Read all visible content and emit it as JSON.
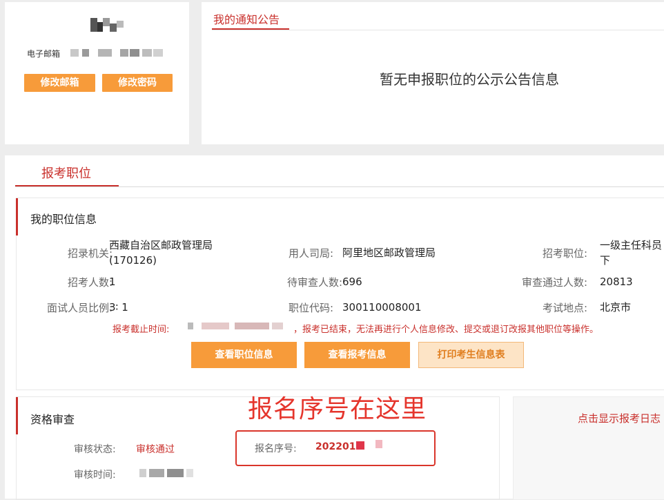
{
  "profile": {
    "email_label": "电子邮箱",
    "buttons": {
      "change_email": "修改邮箱",
      "change_password": "修改密码"
    }
  },
  "notice": {
    "tab": "我的通知公告",
    "empty_message": "暂无申报职位的公示公告信息"
  },
  "main": {
    "tab": "报考职位",
    "position_section": {
      "title": "我的职位信息",
      "fields": {
        "agency_label": "招录机关:",
        "agency_value": "西藏自治区邮政管理局",
        "agency_code": "(170126)",
        "employer_label": "用人司局:",
        "employer_value": "阿里地区邮政管理局",
        "position_label": "招考职位:",
        "position_value_1": "一级主任科员",
        "position_value_2": "下",
        "quota_label": "招考人数:",
        "quota_value": "1",
        "pending_label": "待审查人数:",
        "pending_value": "696",
        "approved_label": "审查通过人数:",
        "approved_value": "20813",
        "ratio_label": "面试人员比例:",
        "ratio_value": "3∶ 1",
        "code_label": "职位代码:",
        "code_value": "300110008001",
        "location_label": "考试地点:",
        "location_value": "北京市"
      },
      "deadline_label": "报考截止时间:",
      "deadline_message": "，报考已结束，无法再进行个人信息修改、提交或退订改报其他职位等操作。",
      "buttons": {
        "view_position": "查看职位信息",
        "view_application": "查看报考信息",
        "print_form": "打印考生信息表"
      }
    },
    "qualification_section": {
      "title": "资格审查",
      "status_label": "审核状态:",
      "status_value": "审核通过",
      "time_label": "审核时间:",
      "serial_label": "报名序号:",
      "serial_value": "2022015",
      "annotation": "报名序号在这里"
    },
    "log_link": "点击显示报考日志"
  },
  "colors": {
    "accent_red": "#c9302c",
    "button_orange": "#f79b3a",
    "annotation_red": "#e5352c"
  }
}
